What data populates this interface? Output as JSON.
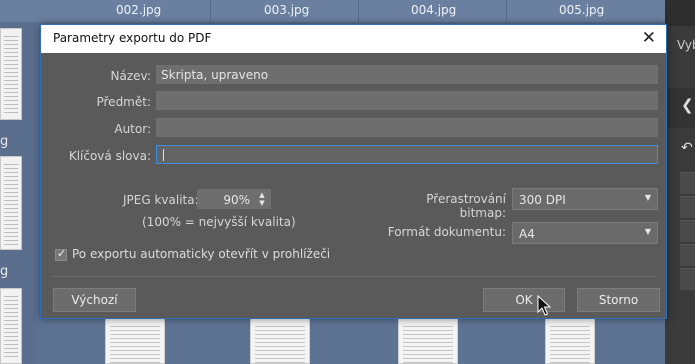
{
  "background": {
    "tabs": [
      "002.jpg",
      "003.jpg",
      "004.jpg",
      "005.jpg"
    ],
    "left_fragment_labels": [
      "g",
      "g"
    ],
    "right_panel_label": "Vyb",
    "right_panel_icons": [
      "chevron-left-icon",
      "rotate-icon"
    ]
  },
  "dialog": {
    "title": "Parametry exportu do PDF",
    "close_glyph": "✕",
    "fields": [
      {
        "label": "Název:",
        "value": "Skripta, upraveno"
      },
      {
        "label": "Předmět:",
        "value": ""
      },
      {
        "label": "Autor:",
        "value": ""
      },
      {
        "label": "Klíčová slova:",
        "value": ""
      }
    ],
    "jpeg": {
      "label": "JPEG kvalita:",
      "value": "90%",
      "hint": "(100% = nejvyšší kvalita)"
    },
    "resample": {
      "label": "Přerastrování bitmap:",
      "value": "300 DPI"
    },
    "format": {
      "label": "Formát dokumentu:",
      "value": "A4"
    },
    "auto_open": {
      "label": "Po exportu automaticky otevřít v prohlížeči",
      "checked": true
    },
    "buttons": {
      "defaults": "Výchozí",
      "ok": "OK",
      "cancel": "Storno"
    }
  }
}
